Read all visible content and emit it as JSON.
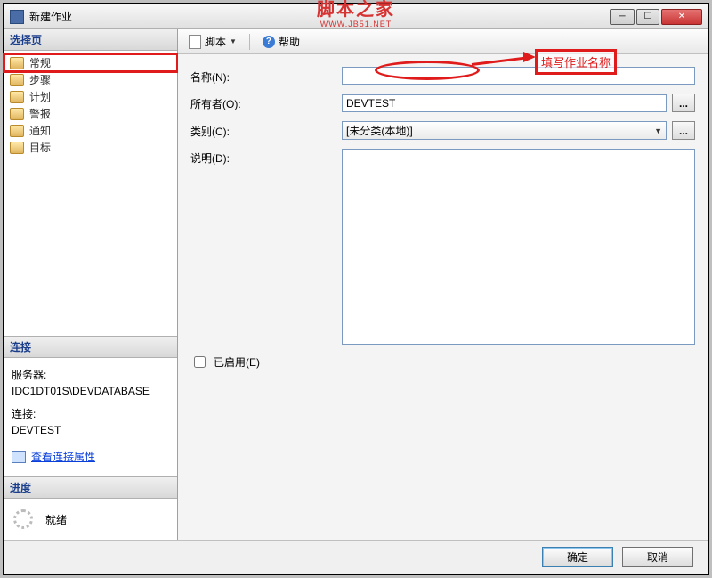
{
  "window": {
    "title": "新建作业"
  },
  "watermark": {
    "line1": "脚本之家",
    "line2": "WWW.JB51.NET"
  },
  "sidebar": {
    "select_page_header": "选择页",
    "items": [
      {
        "label": "常规",
        "selected": true
      },
      {
        "label": "步骤",
        "selected": false
      },
      {
        "label": "计划",
        "selected": false
      },
      {
        "label": "警报",
        "selected": false
      },
      {
        "label": "通知",
        "selected": false
      },
      {
        "label": "目标",
        "selected": false
      }
    ],
    "connection_header": "连接",
    "server_label": "服务器:",
    "server_value": "IDC1DT01S\\DEVDATABASE",
    "conn_label": "连接:",
    "conn_value": "DEVTEST",
    "view_conn_props": "查看连接属性",
    "progress_header": "进度",
    "progress_status": "就绪"
  },
  "toolbar": {
    "script_label": "脚本",
    "help_label": "帮助"
  },
  "form": {
    "name_label": "名称(N):",
    "name_value": "",
    "owner_label": "所有者(O):",
    "owner_value": "DEVTEST",
    "category_label": "类别(C):",
    "category_value": "[未分类(本地)]",
    "desc_label": "说明(D):",
    "desc_value": "",
    "enabled_label": "已启用(E)",
    "enabled_checked": false
  },
  "annotation": {
    "name_hint": "填写作业名称"
  },
  "footer": {
    "ok": "确定",
    "cancel": "取消"
  }
}
